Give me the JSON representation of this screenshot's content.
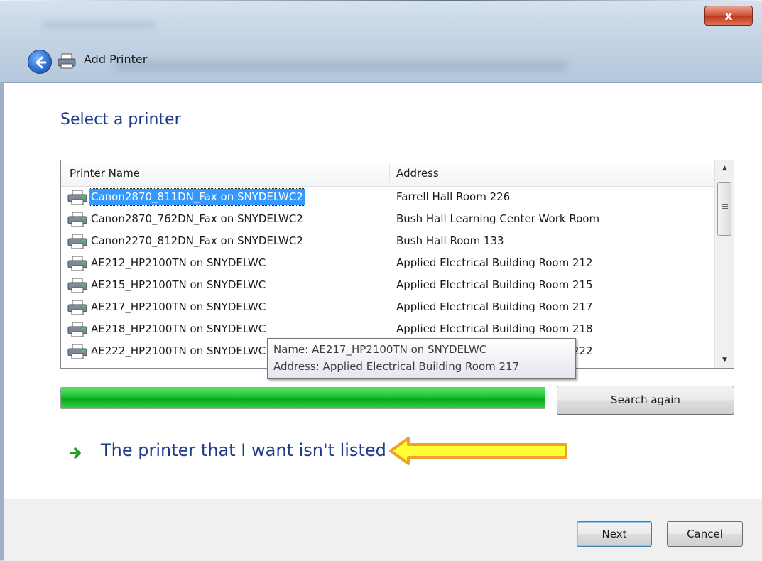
{
  "window": {
    "title": "Add Printer",
    "close_label": "x"
  },
  "heading": "Select a printer",
  "list": {
    "columns": {
      "name": "Printer Name",
      "address": "Address"
    },
    "rows": [
      {
        "name": "Canon2870_811DN_Fax on SNYDELWC2",
        "address": "Farrell Hall Room 226",
        "selected": true
      },
      {
        "name": "Canon2870_762DN_Fax on SNYDELWC2",
        "address": "Bush Hall Learning Center Work Room"
      },
      {
        "name": "Canon2270_812DN_Fax on SNYDELWC2",
        "address": "Bush Hall Room 133"
      },
      {
        "name": "AE212_HP2100TN on SNYDELWC",
        "address": "Applied Electrical Building Room 212"
      },
      {
        "name": "AE215_HP2100TN on SNYDELWC",
        "address": "Applied Electrical Building Room 215"
      },
      {
        "name": "AE217_HP2100TN on SNYDELWC",
        "address": "Applied Electrical Building Room 217"
      },
      {
        "name": "AE218_HP2100TN on SNYDELWC",
        "address": "Applied Electrical Building Room 218"
      },
      {
        "name": "AE222_HP2100TN on SNYDELWC",
        "address": "Applied Electrical Building Room 222"
      }
    ]
  },
  "tooltip": {
    "name_line": "Name: AE217_HP2100TN on SNYDELWC",
    "address_line": "Address: Applied Electrical Building Room 217"
  },
  "progress": {
    "value": 1.0,
    "color": "#19c22b"
  },
  "buttons": {
    "search_again": "Search again",
    "next": "Next",
    "cancel": "Cancel"
  },
  "link": {
    "text": "The printer that I want isn't listed"
  },
  "callout": {
    "fill": "#ffff33",
    "stroke": "#f0a030"
  }
}
